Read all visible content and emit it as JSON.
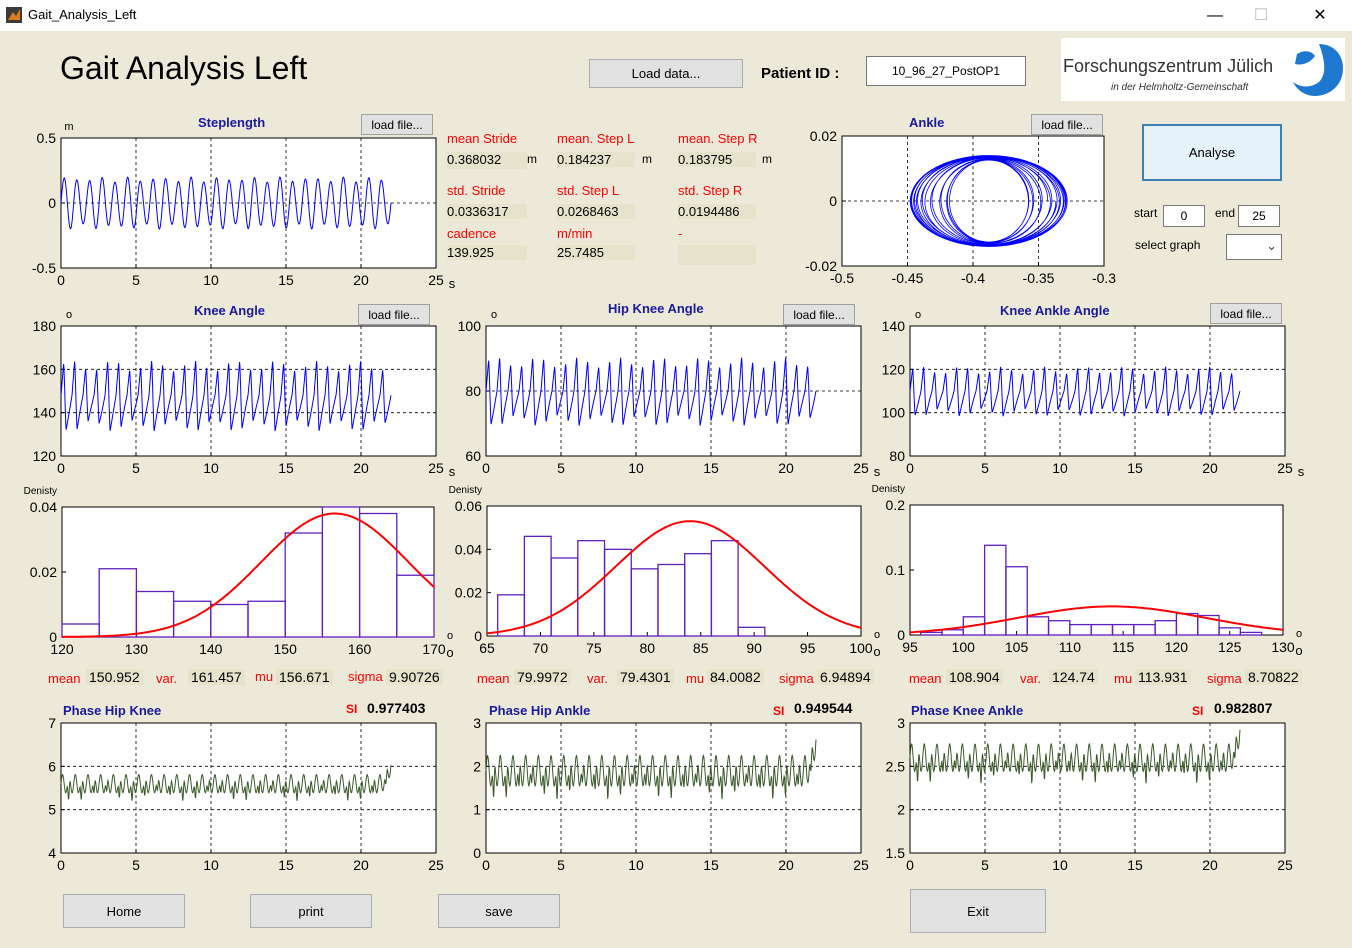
{
  "window": {
    "title": "Gait_Analysis_Left",
    "minimize": "—",
    "maximize": "☐",
    "close": "✕"
  },
  "header": {
    "title": "Gait Analysis Left",
    "load_data": "Load data...",
    "patient_label": "Patient  ID :",
    "patient_id": "10_96_27_PostOP1",
    "logo_main": "Forschungszentrum Jülich",
    "logo_sub": "in der Helmholtz-Gemeinschaft"
  },
  "controls": {
    "analyse": "Analyse",
    "start_label": "start",
    "start_value": "0",
    "end_label": "end",
    "end_value": "25",
    "select_graph_label": "select graph",
    "select_graph_value": ""
  },
  "load_file": "load file...",
  "stats": {
    "mean_stride_label": "mean Stride",
    "mean_stride": "0.368032",
    "m1": "m",
    "mean_stepl_label": "mean. Step L",
    "mean_stepl": "0.184237",
    "m2": "m",
    "mean_stepr_label": "mean. Step R",
    "mean_stepr": "0.183795",
    "m3": "m",
    "std_stride_label": "std. Stride",
    "std_stride": "0.0336317",
    "std_stepl_label": "std. Step L",
    "std_stepl": "0.0268463",
    "std_stepr_label": "std. Step R",
    "std_stepr": "0.0194486",
    "cadence_label": "cadence",
    "cadence": "139.925",
    "mmin_label": "m/min",
    "mmin": "25.7485",
    "dash_label": "-"
  },
  "footer": {
    "home": "Home",
    "print": "print",
    "save": "save",
    "exit": "Exit"
  },
  "colors": {
    "bg": "#ece9d8",
    "signal": "#0000ff",
    "fit": "#ff0000",
    "hist": "#6020c0",
    "phase": "#3a5a2a"
  },
  "chart_data": [
    {
      "id": "steplength",
      "type": "line",
      "title": "Steplength",
      "ylabel_unit": "m",
      "xunit": "s",
      "xlim": [
        0,
        25
      ],
      "ylim": [
        -0.5,
        0.5
      ],
      "xticks": [
        "0",
        "5",
        "10",
        "15",
        "20",
        "25"
      ],
      "yticks": [
        "-0.5",
        "0",
        "0.5"
      ],
      "grid": true,
      "signal_end": 22,
      "periods": 26,
      "amp": 0.2,
      "center": 0,
      "shape": "sine",
      "color": "#0000ff"
    },
    {
      "id": "ankle",
      "type": "line",
      "title": "Ankle",
      "xlim": [
        -0.5,
        -0.3
      ],
      "ylim": [
        -0.02,
        0.02
      ],
      "xticks": [
        "-0.5",
        "-0.45",
        "-0.4",
        "-0.35",
        "-0.3"
      ],
      "yticks": [
        "-0.02",
        "0",
        "0.02"
      ],
      "grid": true,
      "center": [
        -0.4,
        0.0
      ],
      "radius": [
        0.06,
        0.014
      ],
      "loops": 18,
      "color": "#0000ff"
    },
    {
      "id": "knee",
      "type": "line",
      "title": "Knee Angle",
      "ylabel_unit": "o",
      "xunit": "s",
      "xlim": [
        0,
        25
      ],
      "ylim": [
        120,
        180
      ],
      "xticks": [
        "0",
        "5",
        "10",
        "15",
        "20",
        "25"
      ],
      "yticks": [
        "120",
        "140",
        "160",
        "180"
      ],
      "grid": true,
      "signal_end": 22,
      "periods": 30,
      "amp": 17,
      "center": 148,
      "shape": "spike",
      "color": "#0000ff"
    },
    {
      "id": "hipknee",
      "type": "line",
      "title": "Hip Knee Angle",
      "ylabel_unit": "o",
      "xunit": "s",
      "xlim": [
        0,
        25
      ],
      "ylim": [
        60,
        100
      ],
      "xticks": [
        "0",
        "5",
        "10",
        "15",
        "20",
        "25"
      ],
      "yticks": [
        "60",
        "80",
        "100"
      ],
      "grid": true,
      "signal_end": 22,
      "periods": 30,
      "amp": 11,
      "center": 80,
      "shape": "spike",
      "color": "#0000ff"
    },
    {
      "id": "kneeankle",
      "type": "line",
      "title": "Knee Ankle Angle",
      "ylabel_unit": "o",
      "xunit": "s",
      "xlim": [
        0,
        25
      ],
      "ylim": [
        80,
        140
      ],
      "xticks": [
        "0",
        "5",
        "10",
        "15",
        "20",
        "25"
      ],
      "yticks": [
        "80",
        "100",
        "120",
        "140"
      ],
      "grid": true,
      "signal_end": 22,
      "periods": 30,
      "amp": 12,
      "center": 110,
      "shape": "spike",
      "color": "#0000ff"
    },
    {
      "id": "hist1",
      "type": "bar",
      "ylabel": "Denisty",
      "xunit": "o",
      "xlim": [
        120,
        170
      ],
      "ylim": [
        0,
        0.04
      ],
      "xticks": [
        "120",
        "130",
        "140",
        "150",
        "160",
        "170"
      ],
      "yticks": [
        "0",
        "0.02",
        "0.04"
      ],
      "bins": [
        [
          120,
          0.004
        ],
        [
          125,
          0.021
        ],
        [
          130,
          0.014
        ],
        [
          135,
          0.011
        ],
        [
          140,
          0.01
        ],
        [
          145,
          0.011
        ],
        [
          150,
          0.032
        ],
        [
          155,
          0.04
        ],
        [
          160,
          0.038
        ],
        [
          165,
          0.019
        ]
      ],
      "binwidth": 5,
      "fit_mu": 156.671,
      "fit_sigma": 9.90726,
      "fit_peak": 0.038
    },
    {
      "id": "hist2",
      "type": "bar",
      "ylabel": "Denisty",
      "xunit": "o",
      "xlim": [
        65,
        100
      ],
      "ylim": [
        0,
        0.06
      ],
      "xticks": [
        "65",
        "70",
        "75",
        "80",
        "85",
        "90",
        "95",
        "100"
      ],
      "yticks": [
        "0",
        "0.02",
        "0.04",
        "0.06"
      ],
      "bins": [
        [
          66,
          0.019
        ],
        [
          68.5,
          0.046
        ],
        [
          71,
          0.036
        ],
        [
          73.5,
          0.044
        ],
        [
          76,
          0.04
        ],
        [
          78.5,
          0.031
        ],
        [
          81,
          0.033
        ],
        [
          83.5,
          0.038
        ],
        [
          86,
          0.044
        ],
        [
          88.5,
          0.004
        ],
        [
          91,
          0.0
        ]
      ],
      "binwidth": 2.5,
      "fit_mu": 84.0082,
      "fit_sigma": 6.94894,
      "fit_peak": 0.053
    },
    {
      "id": "hist3",
      "type": "bar",
      "ylabel": "Denisty",
      "xunit": "o",
      "xlim": [
        95,
        130
      ],
      "ylim": [
        0,
        0.2
      ],
      "xticks": [
        "95",
        "100",
        "105",
        "110",
        "115",
        "120",
        "125",
        "130"
      ],
      "yticks": [
        "0",
        "0.1",
        "0.2"
      ],
      "bins": [
        [
          96,
          0.004
        ],
        [
          98,
          0.008
        ],
        [
          100,
          0.028
        ],
        [
          102,
          0.138
        ],
        [
          104,
          0.105
        ],
        [
          106,
          0.028
        ],
        [
          108,
          0.022
        ],
        [
          110,
          0.016
        ],
        [
          112,
          0.016
        ],
        [
          114,
          0.016
        ],
        [
          116,
          0.016
        ],
        [
          118,
          0.022
        ],
        [
          120,
          0.033
        ],
        [
          122,
          0.03
        ],
        [
          124,
          0.011
        ],
        [
          126,
          0.004
        ]
      ],
      "binwidth": 2,
      "fit_mu": 113.931,
      "fit_sigma": 8.70822,
      "fit_peak": 0.044
    },
    {
      "id": "phase1",
      "type": "line",
      "title": "Phase Hip Knee",
      "xlim": [
        0,
        25
      ],
      "ylim": [
        4,
        7
      ],
      "xticks": [
        "0",
        "5",
        "10",
        "15",
        "20",
        "25"
      ],
      "yticks": [
        "4",
        "5",
        "6",
        "7"
      ],
      "grid": true,
      "signal_end": 22,
      "periods": 26,
      "amp": 0.6,
      "center": 5.6,
      "shape": "dip",
      "color": "#3a5a2a"
    },
    {
      "id": "phase2",
      "type": "line",
      "title": "Phase Hip Ankle",
      "xlim": [
        0,
        25
      ],
      "ylim": [
        0,
        3
      ],
      "xticks": [
        "0",
        "5",
        "10",
        "15",
        "20",
        "25"
      ],
      "yticks": [
        "0",
        "1",
        "2",
        "3"
      ],
      "grid": true,
      "signal_end": 22,
      "periods": 26,
      "amp": 1.0,
      "center": 1.9,
      "shape": "dip",
      "color": "#3a5a2a"
    },
    {
      "id": "phase3",
      "type": "line",
      "title": "Phase Knee Ankle",
      "xlim": [
        0,
        25
      ],
      "ylim": [
        1.5,
        3
      ],
      "xticks": [
        "0",
        "5",
        "10",
        "15",
        "20",
        "25"
      ],
      "yticks": [
        "1.5",
        "2",
        "2.5",
        "3"
      ],
      "grid": true,
      "signal_end": 22,
      "periods": 26,
      "amp": 0.45,
      "center": 2.6,
      "shape": "dip",
      "color": "#3a5a2a"
    }
  ],
  "hist_stats": [
    {
      "mean_label": "mean",
      "mean": "150.952",
      "var_label": "var.",
      "var": "161.457",
      "mu_label": "mu",
      "mu": "156.671",
      "sigma_label": "sigma",
      "sigma": "9.90726"
    },
    {
      "mean_label": "mean",
      "mean": "79.9972",
      "var_label": "var.",
      "var": "79.4301",
      "mu_label": "mu",
      "mu": "84.0082",
      "sigma_label": "sigma",
      "sigma": "6.94894"
    },
    {
      "mean_label": "mean",
      "mean": "108.904",
      "var_label": "var.",
      "var": "124.74",
      "mu_label": "mu",
      "mu": "113.931",
      "sigma_label": "sigma",
      "sigma": "8.70822"
    }
  ],
  "si": [
    {
      "label": "SI",
      "value": "0.977403"
    },
    {
      "label": "SI",
      "value": "0.949544"
    },
    {
      "label": "SI",
      "value": "0.982807"
    }
  ]
}
